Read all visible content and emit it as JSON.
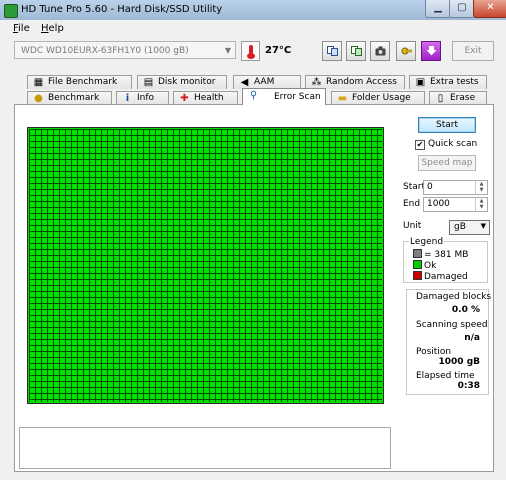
{
  "window": {
    "title": "HD Tune Pro 5.60 - Hard Disk/SSD Utility",
    "controls": {
      "minimize": "▁",
      "maximize": "▢",
      "close": "✕"
    }
  },
  "menu": [
    {
      "label": "File",
      "key": "F",
      "rest": "ile"
    },
    {
      "label": "Help",
      "key": "H",
      "rest": "elp"
    }
  ],
  "toolbar": {
    "drive": "WDC    WD10EURX-63FH1Y0 (1000 gB)",
    "temperature": "27°C",
    "buttons": [
      "copy-text-icon",
      "copy-screenshot-icon",
      "camera-icon",
      "options-icon",
      "download-icon"
    ],
    "exit_label": "Exit"
  },
  "tabs_top": [
    "File Benchmark",
    "Disk monitor",
    "AAM",
    "Random Access",
    "Extra tests"
  ],
  "tabs_bottom": [
    "Benchmark",
    "Info",
    "Health",
    "Error Scan",
    "Folder Usage",
    "Erase"
  ],
  "active_tab": "Error Scan",
  "controls": {
    "start_label": "Start",
    "quick_scan_label": "Quick scan",
    "quick_scan_checked": true,
    "speed_map_label": "Speed map",
    "start_field_label": "Start",
    "start_value": "0",
    "end_field_label": "End",
    "end_value": "1000",
    "unit_label": "Unit",
    "unit_value": "gB"
  },
  "legend": {
    "title": "Legend",
    "items": [
      {
        "label": "= 381 MB",
        "color": "#808080"
      },
      {
        "label": "Ok",
        "color": "#00d000"
      },
      {
        "label": "Damaged",
        "color": "#d00000"
      }
    ]
  },
  "stats": {
    "damaged_blocks_label": "Damaged blocks",
    "damaged_blocks_value": "0.0 %",
    "scanning_speed_label": "Scanning speed",
    "scanning_speed_value": "n/a",
    "position_label": "Position",
    "position_value": "1000 gB",
    "elapsed_label": "Elapsed time",
    "elapsed_value": "0:38"
  },
  "colors": {
    "ok": "#00e100",
    "grid_line": "#004d00",
    "accent": "#3c7fb1"
  }
}
